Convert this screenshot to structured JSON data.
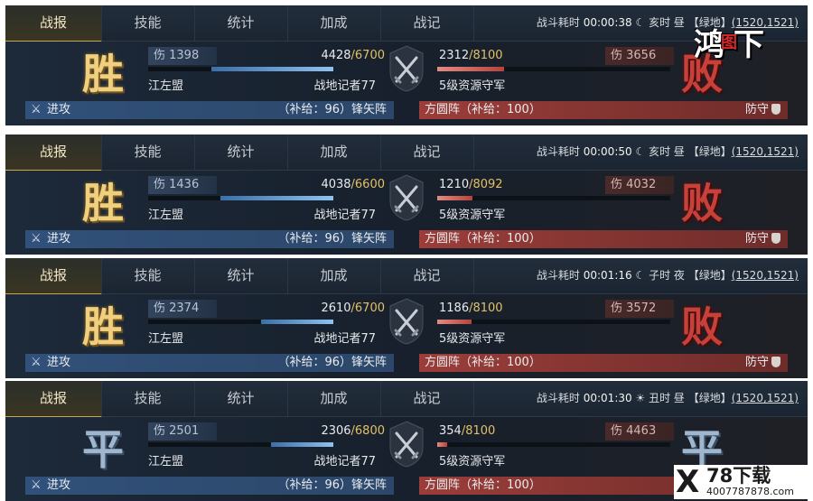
{
  "tabs": [
    "战报",
    "技能",
    "统计",
    "加成",
    "战记"
  ],
  "panels": [
    {
      "info_prefix": "战斗耗时",
      "time": "00:00:38",
      "period_icon": "moon-icon",
      "period": "亥时 昼",
      "terrain": "【绿地】",
      "coord": "(1520,1521)",
      "left_result": "胜",
      "right_result": "败",
      "left_damage": "伤 1398",
      "left_troops": "4428",
      "left_max": "/6700",
      "left_ratio": 0.661,
      "left_alliance": "江左盟",
      "left_name": "战地记者77",
      "right_troops": "2312",
      "right_max": "/8100",
      "right_ratio": 0.285,
      "right_damage": "伤 3656",
      "right_name": "5级资源守军",
      "left_action": "进攻",
      "left_supply": "（补给：96）锋矢阵",
      "right_supply": "方圆阵（补给：100）",
      "right_action": "防守"
    },
    {
      "info_prefix": "战斗耗时",
      "time": "00:00:50",
      "period_icon": "moon-icon",
      "period": "亥时 昼",
      "terrain": "【绿地】",
      "coord": "(1520,1521)",
      "left_result": "胜",
      "right_result": "败",
      "left_damage": "伤 1436",
      "left_troops": "4038",
      "left_max": "/6600",
      "left_ratio": 0.612,
      "left_alliance": "江左盟",
      "left_name": "战地记者77",
      "right_troops": "1210",
      "right_max": "/8092",
      "right_ratio": 0.15,
      "right_damage": "伤 4032",
      "right_name": "5级资源守军",
      "left_action": "进攻",
      "left_supply": "（补给：96）锋矢阵",
      "right_supply": "方圆阵（补给：100）",
      "right_action": "防守"
    },
    {
      "info_prefix": "战斗耗时",
      "time": "00:01:16",
      "period_icon": "moon-icon",
      "period": "子时 夜",
      "terrain": "【绿地】",
      "coord": "(1520,1521)",
      "left_result": "胜",
      "right_result": "败",
      "left_damage": "伤 2374",
      "left_troops": "2610",
      "left_max": "/6700",
      "left_ratio": 0.39,
      "left_alliance": "江左盟",
      "left_name": "战地记者77",
      "right_troops": "1186",
      "right_max": "/8100",
      "right_ratio": 0.146,
      "right_damage": "伤 3572",
      "right_name": "5级资源守军",
      "left_action": "进攻",
      "left_supply": "（补给：96）锋矢阵",
      "right_supply": "方圆阵（补给：100）",
      "right_action": "防守"
    },
    {
      "info_prefix": "战斗耗时",
      "time": "00:01:30",
      "period_icon": "sun-icon",
      "period": "丑时 昼",
      "terrain": "【绿地】",
      "coord": "(1520,1521)",
      "left_result": "平",
      "right_result": "平",
      "left_damage": "伤 2501",
      "left_troops": "2306",
      "left_max": "/6800",
      "left_ratio": 0.339,
      "left_alliance": "江左盟",
      "left_name": "战地记者77",
      "right_troops": "354",
      "right_max": "/8100",
      "right_ratio": 0.044,
      "right_damage": "伤 4463",
      "right_name": "5级资源守军",
      "left_action": "进攻",
      "left_supply": "（补给：96）锋矢阵",
      "right_supply": "方圆阵（补给：100）",
      "right_action": ""
    }
  ],
  "watermark_top": {
    "main": "鸿",
    "mid": "图",
    "end": "下"
  },
  "watermark_bottom": {
    "mark": "X",
    "title": "78下载",
    "url": "4007787878.com"
  }
}
